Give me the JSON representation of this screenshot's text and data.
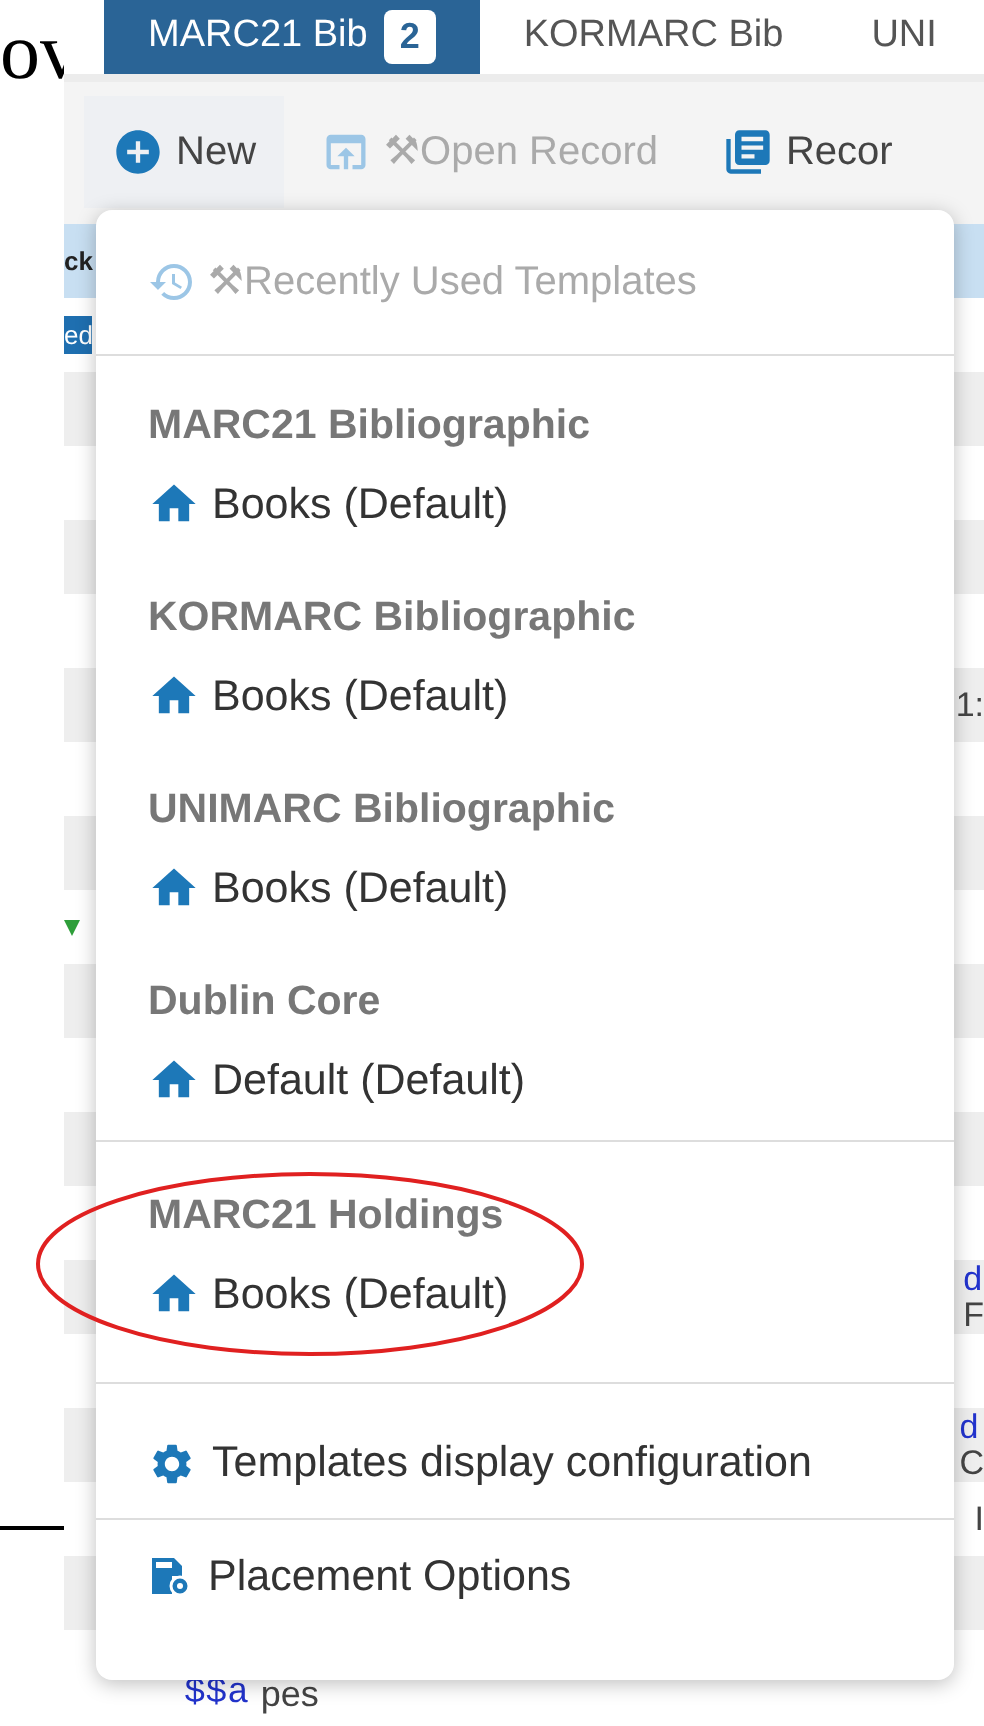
{
  "document_fragment": {
    "text": "ov"
  },
  "tabs": [
    {
      "label": "MARC21 Bib",
      "badge": "2",
      "selected": true
    },
    {
      "label": "KORMARC Bib",
      "selected": false
    },
    {
      "label": "UNI",
      "selected": false
    }
  ],
  "toolbar": [
    {
      "kind": "new",
      "label": "New",
      "disabled": false
    },
    {
      "kind": "open",
      "label": "⚒Open Record",
      "disabled": true
    },
    {
      "kind": "record",
      "label": "Recor",
      "disabled": false
    }
  ],
  "background_rows": [
    {
      "kind": "header",
      "left": "ck"
    },
    {
      "kind": "tag",
      "left": "ed"
    },
    {
      "kind": "plain"
    },
    {
      "kind": "plain"
    },
    {
      "kind": "plain"
    },
    {
      "kind": "plain"
    },
    {
      "kind": "plain",
      "right": [
        "1:"
      ]
    },
    {
      "kind": "plain"
    },
    {
      "kind": "plain"
    },
    {
      "kind": "flag"
    },
    {
      "kind": "plain"
    },
    {
      "kind": "plain"
    },
    {
      "kind": "plain"
    },
    {
      "kind": "plain"
    },
    {
      "kind": "plain",
      "right": [
        "d",
        "F"
      ]
    },
    {
      "kind": "plain"
    },
    {
      "kind": "plain",
      "right": [
        "d",
        "C"
      ]
    },
    {
      "kind": "plain",
      "right": [
        "I"
      ]
    },
    {
      "kind": "plain"
    },
    {
      "kind": "plain",
      "code": "$$a",
      "text": "pes"
    }
  ],
  "new_menu": {
    "recent": {
      "label": "⚒Recently Used Templates",
      "disabled": true
    },
    "groups": [
      {
        "heading": "MARC21 Bibliographic",
        "items": [
          "Books (Default)"
        ],
        "circled": false
      },
      {
        "heading": "KORMARC Bibliographic",
        "items": [
          "Books (Default)"
        ],
        "circled": false
      },
      {
        "heading": "UNIMARC Bibliographic",
        "items": [
          "Books (Default)"
        ],
        "circled": false
      },
      {
        "heading": "Dublin Core",
        "items": [
          "Default (Default)"
        ],
        "circled": false
      },
      {
        "heading": "MARC21 Holdings",
        "items": [
          "Books (Default)"
        ],
        "circled": true
      }
    ],
    "actions": [
      {
        "kind": "settings",
        "label": "Templates display configuration"
      },
      {
        "kind": "placement",
        "label": "Placement Options"
      }
    ]
  }
}
